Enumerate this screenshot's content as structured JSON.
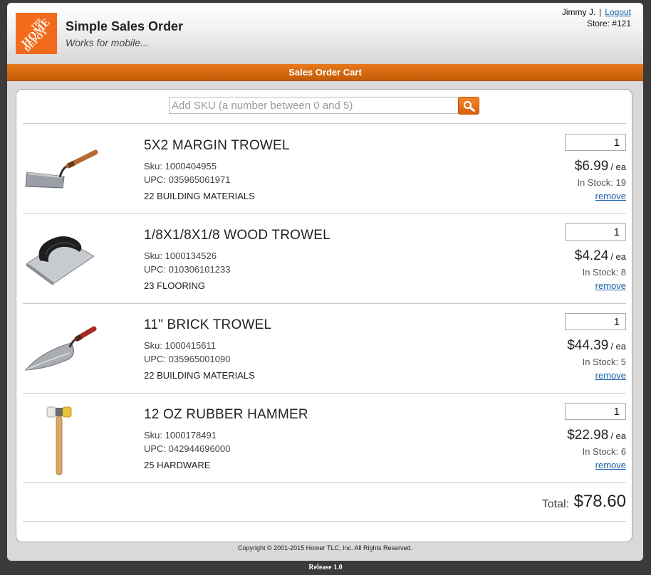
{
  "header": {
    "logo_lines": [
      "THE",
      "HOME",
      "DEPOT"
    ],
    "title": "Simple Sales Order",
    "subtitle": "Works for mobile...",
    "user_name": "Jimmy J.",
    "separator": "|",
    "logout_label": "Logout",
    "store": "Store: #121"
  },
  "titlebar": {
    "title": "Sales Order Cart"
  },
  "search": {
    "placeholder": "Add SKU (a number between 0 and 5)",
    "button_icon": "search-icon"
  },
  "items": [
    {
      "name": "5X2 MARGIN TROWEL",
      "sku": "Sku: 1000404955",
      "upc": "UPC: 035965061971",
      "department": "22 BUILDING MATERIALS",
      "qty": "1",
      "price": "$6.99",
      "unit": "/ ea",
      "stock": "In Stock: 19",
      "remove_label": "remove",
      "image": "margin-trowel-image"
    },
    {
      "name": "1/8X1/8X1/8 WOOD TROWEL",
      "sku": "Sku: 1000134526",
      "upc": "UPC: 010306101233",
      "department": "23 FLOORING",
      "qty": "1",
      "price": "$4.24",
      "unit": "/ ea",
      "stock": "In Stock: 8",
      "remove_label": "remove",
      "image": "notched-trowel-image"
    },
    {
      "name": "11\" BRICK TROWEL",
      "sku": "Sku: 1000415611",
      "upc": "UPC: 035965001090",
      "department": "22 BUILDING MATERIALS",
      "qty": "1",
      "price": "$44.39",
      "unit": "/ ea",
      "stock": "In Stock: 5",
      "remove_label": "remove",
      "image": "brick-trowel-image"
    },
    {
      "name": "12 OZ RUBBER HAMMER",
      "sku": "Sku: 1000178491",
      "upc": "UPC: 042944696000",
      "department": "25 HARDWARE",
      "qty": "1",
      "price": "$22.98",
      "unit": "/ ea",
      "stock": "In Stock: 6",
      "remove_label": "remove",
      "image": "rubber-hammer-image"
    }
  ],
  "total": {
    "label": "Total:",
    "value": "$78.60"
  },
  "footer": {
    "copyright": "Copyright © 2001-2015 Homer TLC, Inc. All Rights Reserved.",
    "release": "Release 1.0"
  },
  "colors": {
    "accent": "#d9600b",
    "logo": "#f26a1b",
    "link": "#1a5fa8"
  }
}
